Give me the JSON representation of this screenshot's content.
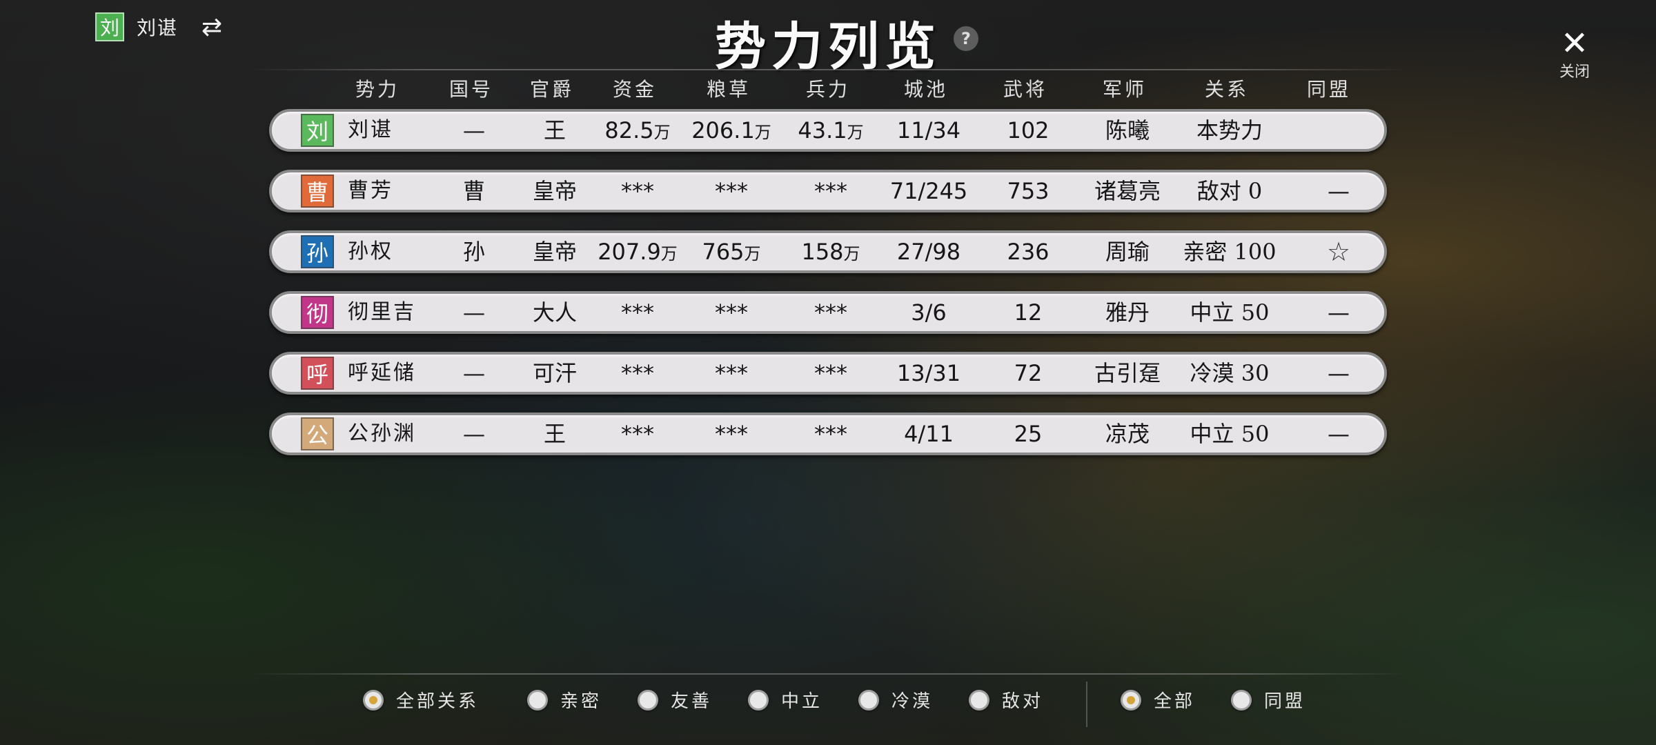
{
  "player": {
    "badge_char": "刘",
    "badge_color": "#4caf50",
    "name": "刘谌",
    "switch_icon": "swap-arrows-icon"
  },
  "title": "势力列览",
  "help_label": "?",
  "close": {
    "icon": "close-icon",
    "label": "关闭"
  },
  "columns": [
    "势力",
    "国号",
    "官爵",
    "资金",
    "粮草",
    "兵力",
    "城池",
    "武将",
    "军师",
    "关系",
    "同盟"
  ],
  "rows": [
    {
      "badge": "刘",
      "color": "#5cb85c",
      "name": "刘谌",
      "guohao": "—",
      "rank": "王",
      "funds": "82.5",
      "funds_unit": "万",
      "food": "206.1",
      "food_unit": "万",
      "troops": "43.1",
      "troops_unit": "万",
      "cities": "11/34",
      "generals": "102",
      "strategist": "陈曦",
      "relation": "本势力",
      "alliance": ""
    },
    {
      "badge": "曹",
      "color": "#e06a3a",
      "name": "曹芳",
      "guohao": "曹",
      "rank": "皇帝",
      "funds": "***",
      "funds_unit": "",
      "food": "***",
      "food_unit": "",
      "troops": "***",
      "troops_unit": "",
      "cities": "71/245",
      "generals": "753",
      "strategist": "诸葛亮",
      "relation": "敌对 0",
      "alliance": "—"
    },
    {
      "badge": "孙",
      "color": "#1f6fb5",
      "name": "孙权",
      "guohao": "孙",
      "rank": "皇帝",
      "funds": "207.9",
      "funds_unit": "万",
      "food": "765",
      "food_unit": "万",
      "troops": "158",
      "troops_unit": "万",
      "cities": "27/98",
      "generals": "236",
      "strategist": "周瑜",
      "relation": "亲密 100",
      "alliance": "☆"
    },
    {
      "badge": "彻",
      "color": "#c2368a",
      "name": "彻里吉",
      "guohao": "—",
      "rank": "大人",
      "funds": "***",
      "funds_unit": "",
      "food": "***",
      "food_unit": "",
      "troops": "***",
      "troops_unit": "",
      "cities": "3/6",
      "generals": "12",
      "strategist": "雅丹",
      "relation": "中立 50",
      "alliance": "—"
    },
    {
      "badge": "呼",
      "color": "#d2505a",
      "name": "呼延储",
      "guohao": "—",
      "rank": "可汗",
      "funds": "***",
      "funds_unit": "",
      "food": "***",
      "food_unit": "",
      "troops": "***",
      "troops_unit": "",
      "cities": "13/31",
      "generals": "72",
      "strategist": "古引趸",
      "relation": "冷漠 30",
      "alliance": "—"
    },
    {
      "badge": "公",
      "color": "#d4a97a",
      "name": "公孙渊",
      "guohao": "—",
      "rank": "王",
      "funds": "***",
      "funds_unit": "",
      "food": "***",
      "food_unit": "",
      "troops": "***",
      "troops_unit": "",
      "cities": "4/11",
      "generals": "25",
      "strategist": "凉茂",
      "relation": "中立 50",
      "alliance": "—"
    }
  ],
  "relation_filters": [
    {
      "label": "全部关系",
      "selected": true
    },
    {
      "label": "亲密",
      "selected": false
    },
    {
      "label": "友善",
      "selected": false
    },
    {
      "label": "中立",
      "selected": false
    },
    {
      "label": "冷漠",
      "selected": false
    },
    {
      "label": "敌对",
      "selected": false
    }
  ],
  "alliance_filters": [
    {
      "label": "全部",
      "selected": true
    },
    {
      "label": "同盟",
      "selected": false
    }
  ]
}
